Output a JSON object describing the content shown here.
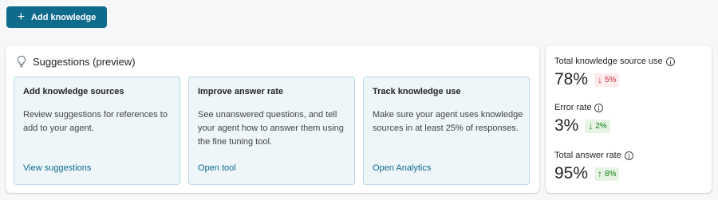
{
  "toolbar": {
    "add_label": "Add knowledge",
    "add_icon": "plus-icon"
  },
  "suggestions": {
    "title": "Suggestions (preview)",
    "icon": "lightbulb-icon",
    "cards": [
      {
        "title": "Add knowledge sources",
        "description": "Review suggestions for references to add to your agent.",
        "link": "View suggestions"
      },
      {
        "title": "Improve answer rate",
        "description": "See unanswered questions, and tell your agent how to answer them using the fine tuning tool.",
        "link": "Open tool"
      },
      {
        "title": "Track knowledge use",
        "description": "Make sure your agent uses knowledge sources in at least 25% of responses.",
        "link": "Open Analytics"
      }
    ]
  },
  "stats": [
    {
      "label": "Total knowledge source use",
      "value": "78%",
      "change": "5%",
      "direction": "down",
      "status": "negative"
    },
    {
      "label": "Error rate",
      "value": "3%",
      "change": "2%",
      "direction": "down",
      "status": "positive"
    },
    {
      "label": "Total answer rate",
      "value": "95%",
      "change": "8%",
      "direction": "up",
      "status": "positive"
    }
  ],
  "colors": {
    "accent": "#0f6b8c",
    "card_bg": "#eef6f9",
    "card_border": "#b8d9e5",
    "negative": "#c4314b",
    "positive": "#107c10"
  }
}
